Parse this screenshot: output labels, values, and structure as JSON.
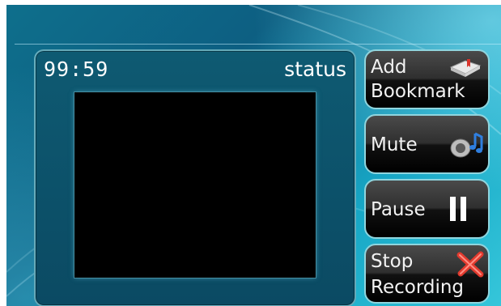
{
  "viewer": {
    "timer": "99:59",
    "status": "status"
  },
  "buttons": {
    "add_bookmark": {
      "line1": "Add",
      "line2": "Bookmark",
      "icon": "bookmark-book-icon"
    },
    "mute": {
      "label": "Mute",
      "icon": "speaker-music-icon"
    },
    "pause": {
      "label": "Pause",
      "icon": "pause-icon"
    },
    "stop_recording": {
      "line1": "Stop",
      "line2": "Recording",
      "icon": "red-x-icon"
    }
  }
}
